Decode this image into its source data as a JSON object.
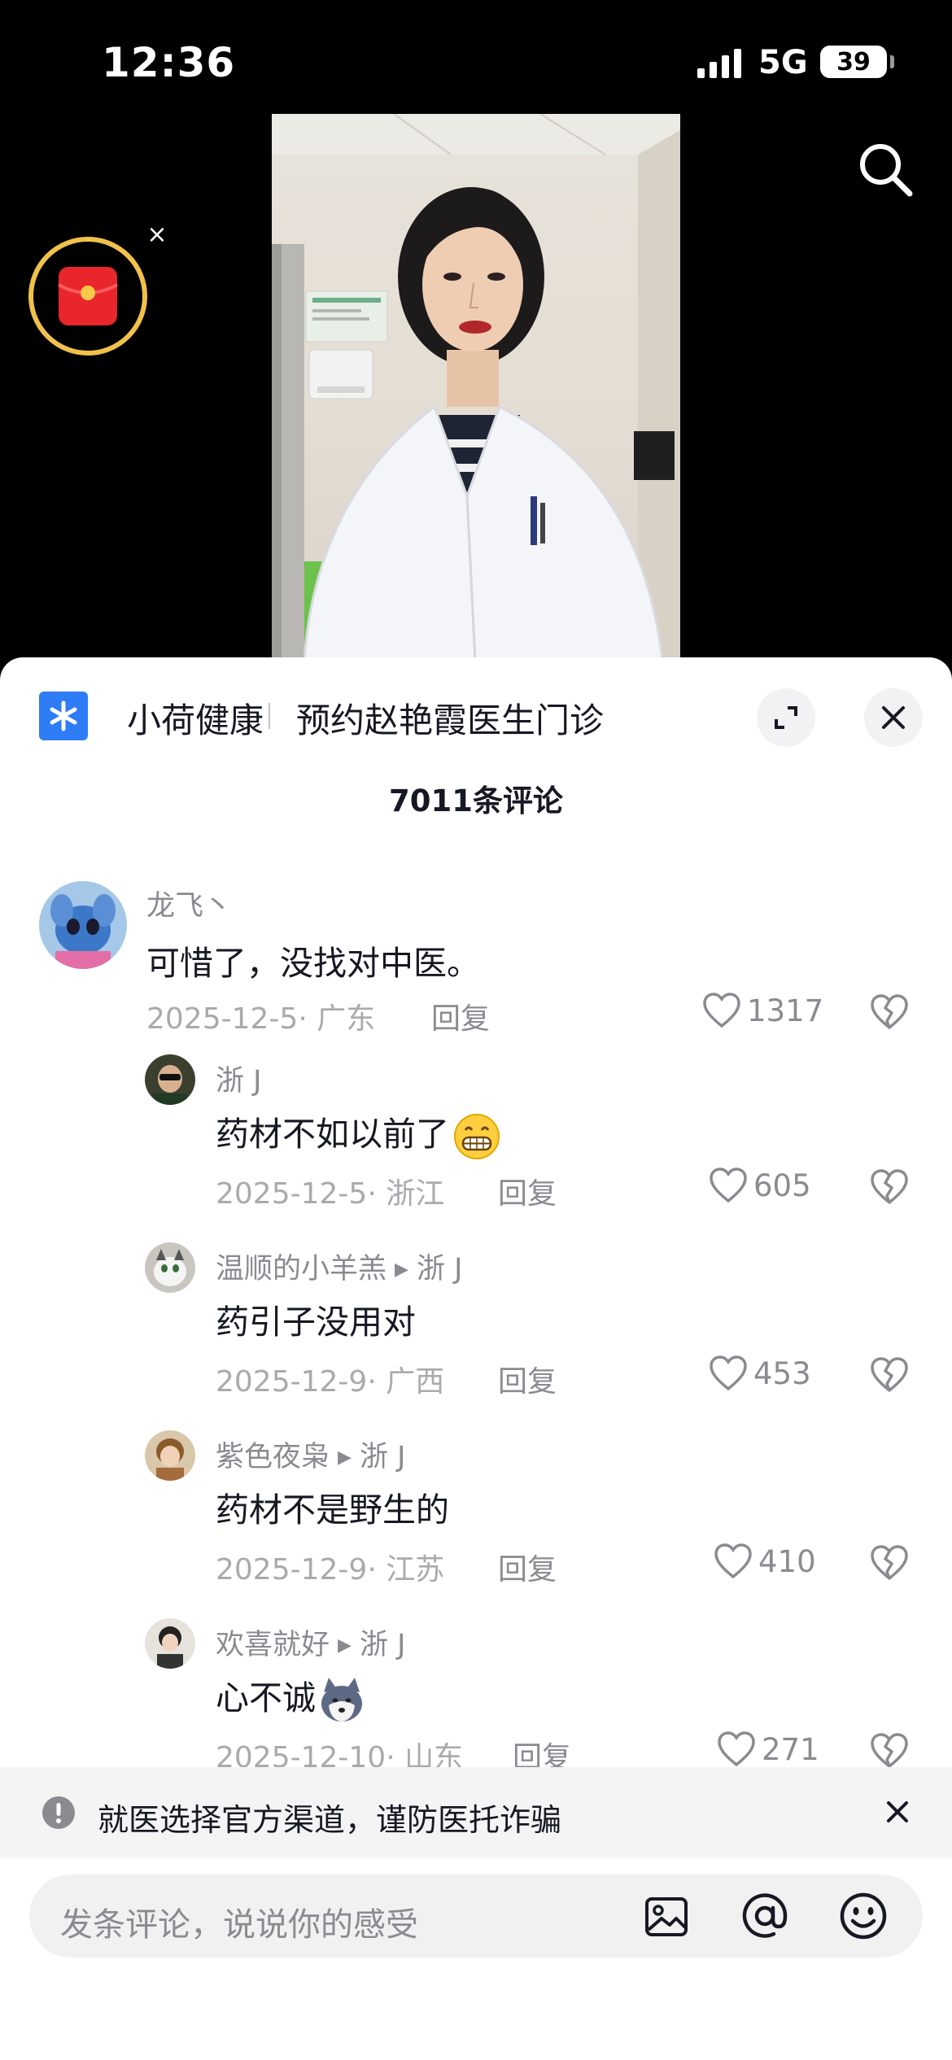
{
  "status_bar": {
    "time": "12:36",
    "network": "5G",
    "battery": "39"
  },
  "panel": {
    "app_name": "小荷健康",
    "app_desc": "预约赵艳霞医生门诊",
    "comment_count": "7011条评论"
  },
  "comments": [
    {
      "user": "龙飞丶",
      "reply_to": "",
      "text": "可惜了，没找对中医。",
      "date": "2025-12-5",
      "location": "· 广东",
      "reply_label": "回复",
      "likes": "1317",
      "emoji": ""
    },
    {
      "user": "浙 J",
      "reply_to": "",
      "text": "药材不如以前了",
      "date": "2025-12-5",
      "location": "· 浙江",
      "reply_label": "回复",
      "likes": "605",
      "emoji": "grin-emoji"
    },
    {
      "user": "温顺的小羊羔",
      "reply_to": "浙 J",
      "text": "药引子没用对",
      "date": "2025-12-9",
      "location": "· 广西",
      "reply_label": "回复",
      "likes": "453",
      "emoji": ""
    },
    {
      "user": "紫色夜枭",
      "reply_to": "浙 J",
      "text": "药材不是野生的",
      "date": "2025-12-9",
      "location": "· 江苏",
      "reply_label": "回复",
      "likes": "410",
      "emoji": ""
    },
    {
      "user": "欢喜就好",
      "reply_to": "浙 J",
      "text": "心不诚",
      "date": "2025-12-10",
      "location": "· 山东",
      "reply_label": "回复",
      "likes": "271",
      "emoji": "husky-emoji"
    }
  ],
  "notice": {
    "text": "就医选择官方渠道，谨防医托诈骗"
  },
  "input": {
    "placeholder": "发条评论，说说你的感受"
  },
  "colors": {
    "accent_blue": "#2e7cf6",
    "text_primary": "#161823",
    "text_secondary": "#8a8b91",
    "red_packet": "#e8262c",
    "ring_gold": "#f0c24b"
  }
}
